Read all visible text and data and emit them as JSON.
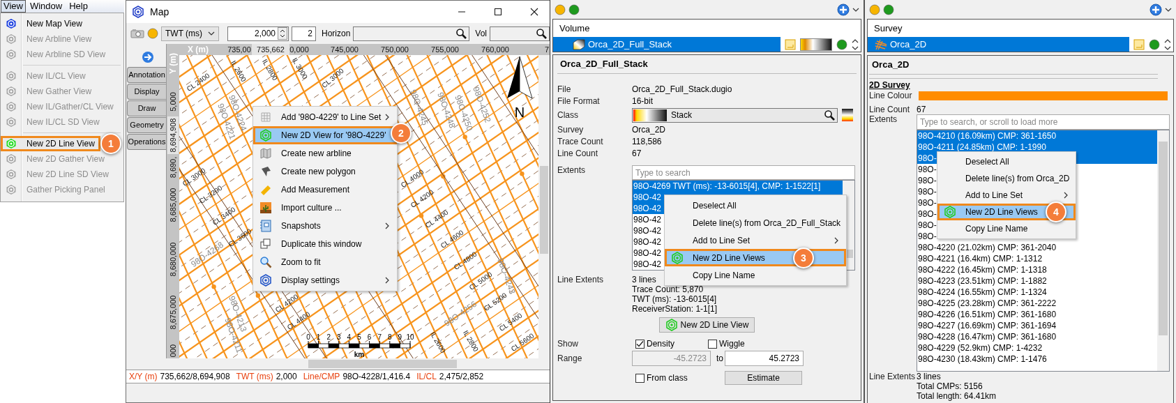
{
  "menu_bar": [
    {
      "label": "View",
      "selected": true
    },
    {
      "label": "Window",
      "selected": false
    },
    {
      "label": "Help",
      "selected": false
    }
  ],
  "view_menu": [
    {
      "kind": "item",
      "label": "New Map View",
      "disabled": false,
      "selected": false
    },
    {
      "kind": "item",
      "label": "New Arbline View",
      "disabled": true,
      "selected": false
    },
    {
      "kind": "item",
      "label": "New Arbline SD View",
      "disabled": true,
      "selected": false
    },
    {
      "kind": "separator"
    },
    {
      "kind": "item",
      "label": "New IL/CL View",
      "disabled": true,
      "selected": false
    },
    {
      "kind": "item",
      "label": "New Gather View",
      "disabled": true,
      "selected": false
    },
    {
      "kind": "item",
      "label": "New IL/Gather/CL View",
      "disabled": true,
      "selected": false
    },
    {
      "kind": "item",
      "label": "New IL/CL SD View",
      "disabled": true,
      "selected": false
    },
    {
      "kind": "separator"
    },
    {
      "kind": "item",
      "label": "New 2D Line View",
      "disabled": false,
      "selected": true
    },
    {
      "kind": "item",
      "label": "New 2D Gather View",
      "disabled": true,
      "selected": false
    },
    {
      "kind": "item",
      "label": "New 2D Line SD View",
      "disabled": true,
      "selected": false
    },
    {
      "kind": "item",
      "label": "Gather Picking Panel",
      "disabled": true,
      "selected": false
    }
  ],
  "map_window": {
    "title": "Map",
    "toolbar": {
      "domain": "TWT (ms)",
      "value": "2,000",
      "step": "2",
      "horizon_label": "Horizon",
      "volume_label": "Vol"
    },
    "tabs": [
      {
        "label": "Annotation",
        "selected": false
      },
      {
        "label": "Display",
        "selected": false
      },
      {
        "label": "Draw",
        "selected": false
      },
      {
        "label": "Geometry",
        "selected": false
      },
      {
        "label": "Operations",
        "selected": false
      }
    ],
    "x_axis_label": "X (m)",
    "y_axis_label": "Y (m)",
    "x_ticks": [
      {
        "label": "735,00",
        "kind": "tick"
      },
      {
        "label": "735,662",
        "kind": "cursor"
      },
      {
        "label": "0,000",
        "kind": "tick"
      },
      {
        "label": "745,000",
        "kind": "tick"
      },
      {
        "label": "750,000",
        "kind": "tick"
      },
      {
        "label": "755,000",
        "kind": "tick"
      },
      {
        "label": "760,000",
        "kind": "tick"
      },
      {
        "label": "7",
        "kind": "tick"
      }
    ],
    "y_ticks": [
      {
        "label": "5,000",
        "kind": "tick"
      },
      {
        "label": "8,694,908",
        "kind": "cursor"
      },
      {
        "label": "8,690,",
        "kind": "tick"
      },
      {
        "label": "8,685,000",
        "kind": "tick"
      },
      {
        "label": "8,680,000",
        "kind": "tick"
      },
      {
        "label": "8,675,000",
        "kind": "tick"
      },
      {
        "label": "000",
        "kind": "tick"
      }
    ],
    "map_labels": [
      {
        "text": "CL 2400",
        "kind": "crossline"
      },
      {
        "text": "IL 2600",
        "kind": "inline"
      },
      {
        "text": "IL 2800",
        "kind": "inline"
      },
      {
        "text": "IL 3000",
        "kind": "inline"
      },
      {
        "text": "CL 3000",
        "kind": "crossline"
      },
      {
        "text": "98O-4221",
        "kind": "line"
      },
      {
        "text": "98O-4224",
        "kind": "line"
      },
      {
        "text": "CL 3000",
        "kind": "crossline"
      },
      {
        "text": "CL 3200",
        "kind": "crossline"
      },
      {
        "text": "CL 3400",
        "kind": "crossline"
      },
      {
        "text": "CL 3600",
        "kind": "crossline"
      },
      {
        "text": "98O-4268",
        "kind": "line"
      },
      {
        "text": "CL 4000",
        "kind": "crossline"
      },
      {
        "text": "CL 4200",
        "kind": "crossline"
      },
      {
        "text": "CL 4400",
        "kind": "crossline"
      },
      {
        "text": "CL 4600",
        "kind": "crossline"
      },
      {
        "text": "CL 4800",
        "kind": "crossline"
      },
      {
        "text": "CL 5000",
        "kind": "crossline"
      },
      {
        "text": "CL 5200",
        "kind": "crossline"
      },
      {
        "text": "CL 5400",
        "kind": "crossline"
      },
      {
        "text": "CL 5600",
        "kind": "crossline"
      },
      {
        "text": "98O-4245",
        "kind": "line"
      },
      {
        "text": "98O-4248",
        "kind": "line"
      },
      {
        "text": "98O-4250",
        "kind": "line"
      },
      {
        "text": "98O-4252",
        "kind": "line"
      },
      {
        "text": "98O-4243",
        "kind": "line"
      },
      {
        "text": "98O-4256",
        "kind": "line"
      },
      {
        "text": "98O-4213",
        "kind": "line"
      },
      {
        "text": "98O-4211",
        "kind": "line"
      },
      {
        "text": "CL 4200",
        "kind": "crossline"
      },
      {
        "text": "CL 4400",
        "kind": "crossline"
      },
      {
        "text": "IL 2600",
        "kind": "inline"
      },
      {
        "text": "IL 2800",
        "kind": "inline"
      }
    ],
    "north_label": "N",
    "scale_bar": {
      "ticks": [
        "0",
        "1",
        "2",
        "3",
        "4",
        "5",
        "6",
        "7",
        "8",
        "9",
        "10"
      ],
      "unit": "km"
    },
    "context_menu": [
      {
        "kind": "lineset",
        "label": "Add '98O-4229' to Line Set",
        "has_submenu": true,
        "selected": false
      },
      {
        "kind": "view2d",
        "label": "New 2D View for '98O-4229'",
        "has_submenu": false,
        "selected": true
      },
      {
        "kind": "arbline",
        "label": "Create new arbline",
        "has_submenu": false,
        "selected": false
      },
      {
        "kind": "polygon",
        "label": "Create new polygon",
        "has_submenu": false,
        "selected": false
      },
      {
        "kind": "measure",
        "label": "Add Measurement",
        "has_submenu": false,
        "selected": false
      },
      {
        "kind": "culture",
        "label": "Import culture ...",
        "has_submenu": false,
        "selected": false
      },
      {
        "kind": "snapshots",
        "label": "Snapshots",
        "has_submenu": true,
        "selected": false
      },
      {
        "kind": "duplicate",
        "label": "Duplicate this window",
        "has_submenu": false,
        "selected": false
      },
      {
        "kind": "zoom",
        "label": "Zoom to fit",
        "has_submenu": false,
        "selected": false
      },
      {
        "kind": "display",
        "label": "Display settings",
        "has_submenu": true,
        "selected": false
      }
    ],
    "status_bar": [
      {
        "label": "X/Y (m)",
        "value": "735,662/8,694,908"
      },
      {
        "label": "TWT (ms)",
        "value": "2,000"
      },
      {
        "label": "Line/CMP",
        "value": "98O-4228/1,416.4"
      },
      {
        "label": "IL/CL",
        "value": "2,475/2,852"
      }
    ]
  },
  "volume_panel": {
    "kind": "volume",
    "column_header": "Volume",
    "layer": {
      "label": "Orca_2D_Full_Stack",
      "selected": true
    },
    "title": "Orca_2D_Full_Stack",
    "properties": [
      {
        "kind": "text",
        "label": "File",
        "value": "Orca_2D_Full_Stack.dugio"
      },
      {
        "kind": "text",
        "label": "File Format",
        "value": "16-bit"
      },
      {
        "kind": "colorbar",
        "label": "Class",
        "value": "Stack"
      },
      {
        "kind": "text",
        "label": "Survey",
        "value": "Orca_2D"
      },
      {
        "kind": "text",
        "label": "Trace Count",
        "value": "118,586"
      },
      {
        "kind": "text",
        "label": "Line Count",
        "value": "67"
      }
    ],
    "extents": {
      "label": "Extents",
      "placeholder": "Type to search",
      "rows": [
        {
          "text": "98O-4269 TWT (ms): -13-6015[4], CMP: 1-1522[1]",
          "selected": true
        },
        {
          "text": "98O-42",
          "selected": true
        },
        {
          "text": "98O-42",
          "selected": true
        },
        {
          "text": "98O-42",
          "selected": false
        },
        {
          "text": "98O-42",
          "selected": false
        },
        {
          "text": "98O-42",
          "selected": false
        },
        {
          "text": "98O-42",
          "selected": false
        },
        {
          "text": "98O-42",
          "selected": false
        }
      ]
    },
    "line_extents": {
      "label": "Line Extents",
      "lines": [
        "3 lines",
        "Trace Count: 5,870",
        "TWT (ms): -13-6015[4]",
        "ReceiverStation: 1-1[1]"
      ]
    },
    "new_view_button": "New 2D Line View",
    "show": {
      "label": "Show",
      "options": [
        {
          "label": "Density",
          "checked": true
        },
        {
          "label": "Wiggle",
          "checked": false
        }
      ]
    },
    "range": {
      "label": "Range",
      "min": "-45.2723",
      "min_disabled": true,
      "separator": "to",
      "max": "45.2723"
    },
    "from_class": {
      "label": "From class",
      "checked": false
    },
    "estimate_button": "Estimate",
    "context_menu": [
      {
        "kind": "plain",
        "label": "Deselect All",
        "has_submenu": false,
        "selected": false
      },
      {
        "kind": "plain",
        "label": "Delete line(s) from Orca_2D_Full_Stack",
        "has_submenu": false,
        "selected": false
      },
      {
        "kind": "plain",
        "label": "Add to Line Set",
        "has_submenu": true,
        "selected": false
      },
      {
        "kind": "view2d",
        "label": "New 2D Line Views",
        "has_submenu": false,
        "selected": true
      },
      {
        "kind": "plain",
        "label": "Copy Line Name",
        "has_submenu": false,
        "selected": false
      }
    ]
  },
  "survey_panel": {
    "kind": "survey",
    "column_header": "Survey",
    "layer": {
      "label": "Orca_2D",
      "selected": true
    },
    "title": "Orca_2D",
    "section": "2D Survey",
    "line_colour_label": "Line Colour",
    "line_count": {
      "label": "Line Count",
      "value": "67"
    },
    "extents": {
      "label": "Extents",
      "placeholder": "Type to search, or scroll to load more",
      "rows": [
        {
          "text": "98O-4210 (16.09km) CMP: 361-1650",
          "selected": true
        },
        {
          "text": "98O-4211 (24.85km) CMP: 1-1990",
          "selected": true
        },
        {
          "text": "98O-",
          "selected": true
        },
        {
          "text": "98O-",
          "selected": false
        },
        {
          "text": "98O-",
          "selected": false
        },
        {
          "text": "98O-",
          "selected": false
        },
        {
          "text": "98O-",
          "selected": false
        },
        {
          "text": "98O-",
          "selected": false
        },
        {
          "text": "98O-",
          "selected": false
        },
        {
          "text": "98O-",
          "selected": false
        },
        {
          "text": "98O-4220 (21.02km) CMP: 361-2040",
          "selected": false
        },
        {
          "text": "98O-4221 (16.4km) CMP: 1-1312",
          "selected": false
        },
        {
          "text": "98O-4222 (16.45km) CMP: 1-1318",
          "selected": false
        },
        {
          "text": "98O-4223 (23.51km) CMP: 1-1882",
          "selected": false
        },
        {
          "text": "98O-4224 (16.55km) CMP: 1-1324",
          "selected": false
        },
        {
          "text": "98O-4225 (23.28km) CMP: 361-2222",
          "selected": false
        },
        {
          "text": "98O-4226 (16.51km) CMP: 361-1680",
          "selected": false
        },
        {
          "text": "98O-4227 (16.69km) CMP: 361-1694",
          "selected": false
        },
        {
          "text": "98O-4228 (16.47km) CMP: 361-1680",
          "selected": false
        },
        {
          "text": "98O-4229 (52.9km) CMP: 1-4232",
          "selected": false
        },
        {
          "text": "98O-4230 (18.43km) CMP: 1-1476",
          "selected": false
        }
      ]
    },
    "line_extents": {
      "label": "Line Extents",
      "lines": [
        "3 lines",
        "Total CMPs: 5156",
        "Total length: 64.41km"
      ]
    },
    "context_menu": [
      {
        "kind": "plain",
        "label": "Deselect All",
        "has_submenu": false,
        "selected": false
      },
      {
        "kind": "plain",
        "label": "Delete line(s) from Orca_2D",
        "has_submenu": false,
        "selected": false
      },
      {
        "kind": "plain",
        "label": "Add to Line Set",
        "has_submenu": true,
        "selected": false
      },
      {
        "kind": "view2d",
        "label": "New 2D Line Views",
        "has_submenu": false,
        "selected": true
      },
      {
        "kind": "plain",
        "label": "Copy Line Name",
        "has_submenu": false,
        "selected": false
      }
    ]
  },
  "callouts": [
    "1",
    "2",
    "3",
    "4"
  ]
}
